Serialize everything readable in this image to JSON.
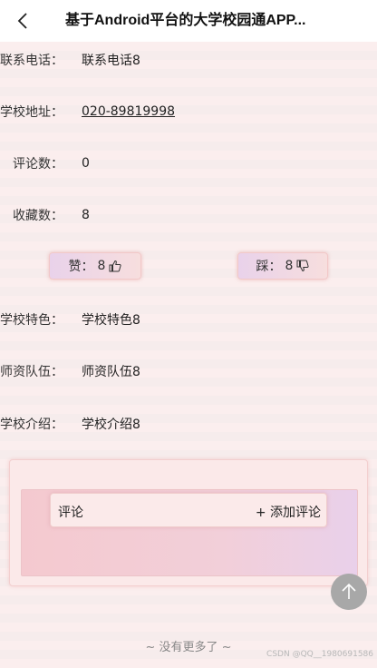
{
  "header": {
    "title": "基于Android平台的大学校园通APP..."
  },
  "details": [
    {
      "label": "联系电话：",
      "value": "联系电话8"
    },
    {
      "label": "学校地址：",
      "value": "020-89819998"
    },
    {
      "label": "评论数：",
      "value": "0"
    },
    {
      "label": "收藏数：",
      "value": "8"
    }
  ],
  "votes": {
    "like_label": "赞：",
    "like_count": "8",
    "dislike_label": "踩：",
    "dislike_count": "8"
  },
  "details2": [
    {
      "label": "学校特色：",
      "value": "学校特色8"
    },
    {
      "label": "师资队伍：",
      "value": "师资队伍8"
    },
    {
      "label": "学校介绍：",
      "value": "学校介绍8"
    }
  ],
  "comments": {
    "title": "评论",
    "add_label": "+ 添加评论"
  },
  "footer": {
    "no_more": "~ 没有更多了 ~",
    "watermark": "CSDN @QQ__1980691586"
  },
  "colors": {
    "background": "#f6efef",
    "accent_pink": "#f4c9cf",
    "accent_lavender": "#e9d0ea"
  },
  "icons": [
    "chevron-left-icon",
    "thumbs-up-icon",
    "thumbs-down-icon",
    "arrow-up-icon"
  ]
}
